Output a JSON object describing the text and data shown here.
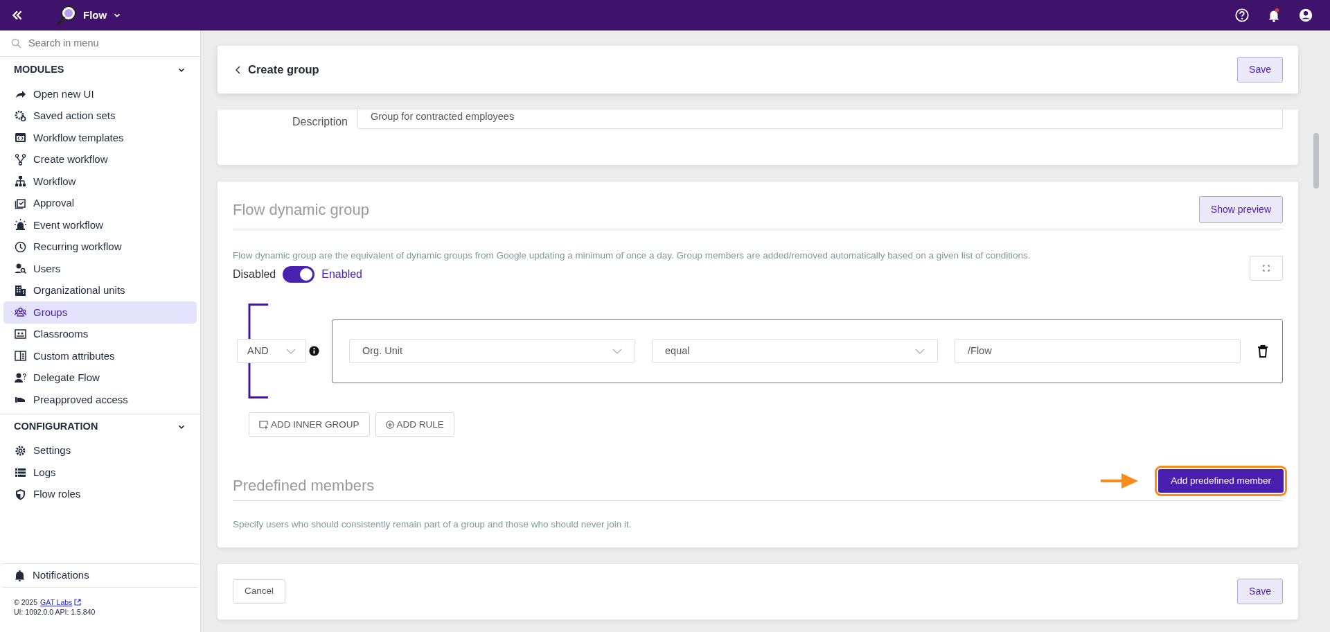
{
  "topbar": {
    "app_name": "Flow"
  },
  "sidebar": {
    "search": {
      "placeholder": "Search in menu"
    },
    "sections": [
      {
        "title": "MODULES",
        "expanded": true,
        "items": [
          {
            "label": "Open new UI",
            "selected": false
          },
          {
            "label": "Saved action sets",
            "selected": false
          },
          {
            "label": "Workflow templates",
            "selected": false
          },
          {
            "label": "Create workflow",
            "selected": false
          },
          {
            "label": "Workflow",
            "selected": false
          },
          {
            "label": "Approval",
            "selected": false
          },
          {
            "label": "Event workflow",
            "selected": false
          },
          {
            "label": "Recurring workflow",
            "selected": false
          },
          {
            "label": "Users",
            "selected": false
          },
          {
            "label": "Organizational units",
            "selected": false
          },
          {
            "label": "Groups",
            "selected": true
          },
          {
            "label": "Classrooms",
            "selected": false
          },
          {
            "label": "Custom attributes",
            "selected": false
          },
          {
            "label": "Delegate Flow",
            "selected": false
          },
          {
            "label": "Preapproved access",
            "selected": false
          }
        ]
      },
      {
        "title": "CONFIGURATION",
        "expanded": true,
        "items": [
          {
            "label": "Settings",
            "selected": false
          },
          {
            "label": "Logs",
            "selected": false
          },
          {
            "label": "Flow roles",
            "selected": false
          }
        ]
      }
    ],
    "notifications": "Notifications",
    "footer": {
      "copyright": "© 2025",
      "link": "GAT Labs",
      "version": "UI: 1092.0.0 API: 1.5.840"
    }
  },
  "header": {
    "title": "Create group",
    "save": "Save"
  },
  "description": {
    "label": "Description",
    "value": "Group for contracted employees"
  },
  "dynamic_group": {
    "title": "Flow dynamic group",
    "preview_button": "Show preview",
    "help": "Flow dynamic group are the equivalent of dynamic groups from Google updating a minimum of once a day. Group members are added/removed automatically based on a given list of conditions.",
    "toggle": {
      "off_label": "Disabled",
      "on_label": "Enabled",
      "on": true
    },
    "operator": "AND",
    "rule": {
      "field": "Org. Unit",
      "condition": "equal",
      "value": "/Flow"
    },
    "add_inner_group": "ADD INNER GROUP",
    "add_rule": "ADD RULE"
  },
  "predefined": {
    "title": "Predefined members",
    "button": "Add predefined member",
    "highlighted": true,
    "help": "Specify users who should consistently remain part of a group and those who should never join it."
  },
  "footer": {
    "cancel": "Cancel",
    "save": "Save"
  }
}
